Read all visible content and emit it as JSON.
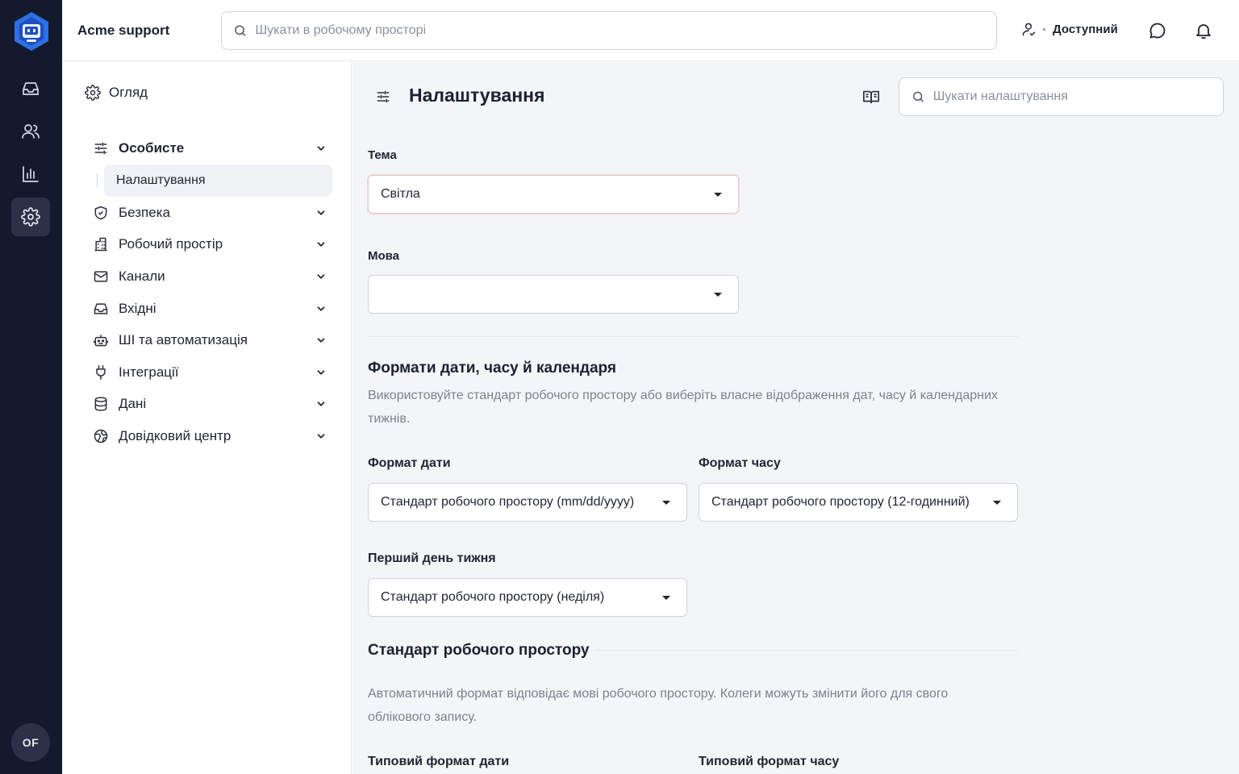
{
  "app": {
    "title": "Acme support"
  },
  "search": {
    "placeholder": "Шукати в робочому просторі"
  },
  "status": {
    "label": "Доступний"
  },
  "user": {
    "initials": "OF"
  },
  "rail": {
    "items": [
      "inbox-icon",
      "contacts-icon",
      "reports-icon",
      "settings-icon"
    ],
    "active": "settings-icon"
  },
  "sidebar": {
    "overview": "Огляд",
    "groups": [
      {
        "label": "Особисте",
        "icon": "sliders-icon",
        "open": true
      },
      {
        "label": "Безпека",
        "icon": "shield-icon"
      },
      {
        "label": "Робочий простір",
        "icon": "building-icon"
      },
      {
        "label": "Канали",
        "icon": "mail-icon"
      },
      {
        "label": "Вхідні",
        "icon": "inbox-icon"
      },
      {
        "label": "ШІ та автоматизація",
        "icon": "robot-icon"
      },
      {
        "label": "Інтеграції",
        "icon": "plug-icon"
      },
      {
        "label": "Дані",
        "icon": "database-icon"
      },
      {
        "label": "Довідковий центр",
        "icon": "globe-icon"
      }
    ],
    "active_subitem": "Налаштування"
  },
  "main": {
    "title": "Налаштування",
    "settings_search_placeholder": "Шукати налаштування",
    "theme": {
      "label": "Тема",
      "value": "Світла"
    },
    "language": {
      "label": "Мова",
      "value": ""
    },
    "formats_section": {
      "title": "Формати дати, часу й календаря",
      "description": "Використовуйте стандарт робочого простору або виберіть власне відображення дат, часу й календарних тижнів."
    },
    "date_format": {
      "label": "Формат дати",
      "value": "Стандарт робочого простору (mm/dd/yyyy)"
    },
    "time_format": {
      "label": "Формат часу",
      "value": "Стандарт робочого простору (12-годинний)"
    },
    "first_day": {
      "label": "Перший день тижня",
      "value": "Стандарт робочого простору (неділя)"
    },
    "workspace_default": {
      "title": "Стандарт робочого простору",
      "description": "Автоматичний формат відповідає мові робочого простору. Колеги можуть змінити його для свого облікового запису.",
      "default_date_label": "Типовий формат дати",
      "default_time_label": "Типовий формат часу"
    }
  },
  "colors": {
    "rail": "#141a2e",
    "logo": "#2f6fe6",
    "main_bg": "#f4f5f7"
  }
}
